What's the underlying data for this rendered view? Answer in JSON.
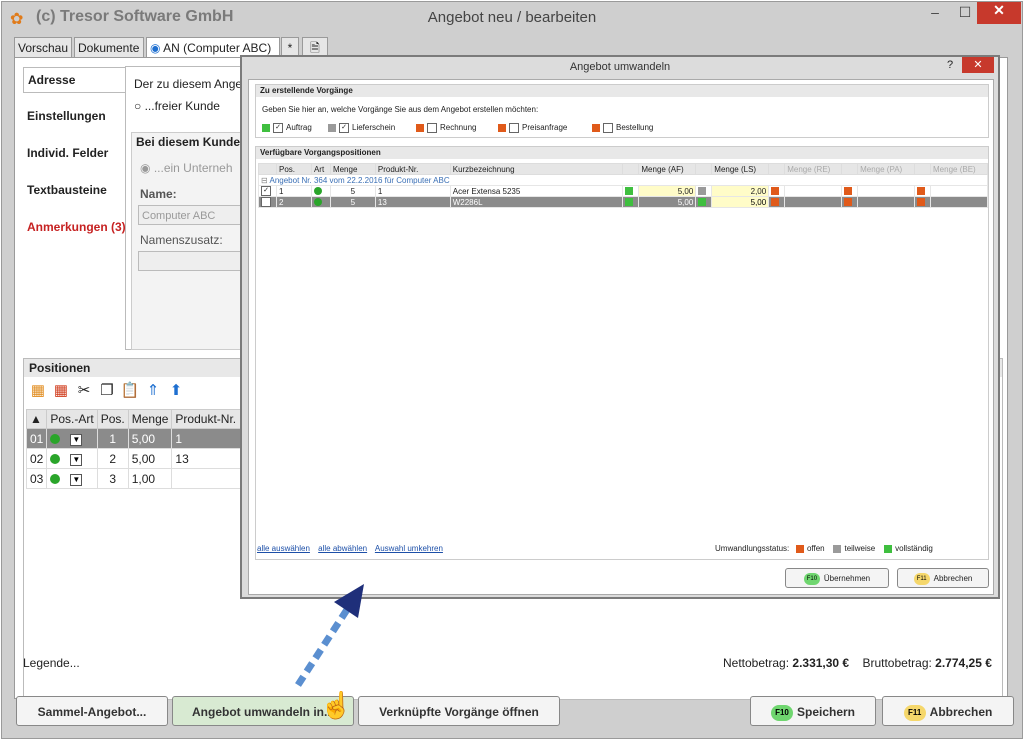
{
  "app": {
    "title": "(c) Tresor Software GmbH",
    "doc_title": "Angebot neu / bearbeiten",
    "min": "–",
    "max": "☐",
    "close": "✕"
  },
  "tabs": {
    "vorschau": "Vorschau",
    "dokumente": "Dokumente",
    "an": "AN (Computer ABC)",
    "star": "*"
  },
  "nav": {
    "adresse": "Adresse",
    "einstellungen": "Einstellungen",
    "felder": "Individ. Felder",
    "textbausteine": "Textbausteine",
    "anmerkungen": "Anmerkungen (3)"
  },
  "address": {
    "question": "Der zu diesem Ange",
    "radio_free": "...freier Kunde",
    "section": "Bei diesem Kunder",
    "radio_company": "...ein Unterneh",
    "name_label": "Name:",
    "name_value": "Computer ABC",
    "namenszusatz_label": "Namenszusatz:"
  },
  "positions": {
    "title": "Positionen",
    "headers": [
      "▲",
      "Pos.-Art",
      "Pos.",
      "Menge",
      "Produkt-Nr."
    ],
    "rows": [
      {
        "idx": "01",
        "pos": "1",
        "menge": "5,00",
        "produkt": "1"
      },
      {
        "idx": "02",
        "pos": "2",
        "menge": "5,00",
        "produkt": "13"
      },
      {
        "idx": "03",
        "pos": "3",
        "menge": "1,00",
        "produkt": ""
      }
    ],
    "legende": "Legende...",
    "netto_label": "Nettobetrag:",
    "netto_value": "2.331,30 €",
    "brutto_label": "Bruttobetrag:",
    "brutto_value": "2.774,25 €"
  },
  "buttons": {
    "sammel": "Sammel-Angebot...",
    "umwandeln": "Angebot umwandeln in...",
    "verknuepft": "Verknüpfte Vorgänge öffnen",
    "speichern": "Speichern",
    "speichern_key": "F10",
    "abbrechen": "Abbrechen",
    "abbrechen_key": "F11"
  },
  "dialog": {
    "title": "Angebot umwandeln",
    "help": "?",
    "close": "✕",
    "group1": "Zu erstellende Vorgänge",
    "hint": "Geben Sie hier an, welche Vorgänge Sie aus dem Angebot erstellen möchten:",
    "options": [
      {
        "label": "Auftrag",
        "checked": true,
        "color": "#3fbf3f"
      },
      {
        "label": "Lieferschein",
        "checked": true,
        "color": "#9a9a9a"
      },
      {
        "label": "Rechnung",
        "checked": false,
        "color": "#e05a1a"
      },
      {
        "label": "Preisanfrage",
        "checked": false,
        "color": "#e05a1a"
      },
      {
        "label": "Bestellung",
        "checked": false,
        "color": "#e05a1a"
      }
    ],
    "group2": "Verfügbare Vorgangspositionen",
    "headers": [
      "Pos.",
      "Art",
      "Menge",
      "Produkt-Nr.",
      "Kurzbezeichnung",
      "Menge (AF)",
      "Menge (LS)",
      "Menge (RE)",
      "Menge (PA)",
      "Menge (BE)"
    ],
    "group_row": "Angebot Nr. 364 vom 22.2.2016 für Computer ABC",
    "rows": [
      {
        "pos": "1",
        "menge": "5",
        "produkt": "1",
        "kurz": "Acer Extensa 5235",
        "af": "5,00",
        "ls": "2,00"
      },
      {
        "pos": "2",
        "menge": "5",
        "produkt": "13",
        "kurz": "W2286L",
        "af": "5,00",
        "ls": "5,00"
      }
    ],
    "link_all": "alle auswählen",
    "link_none": "alle abwählen",
    "link_invert": "Auswahl umkehren",
    "status_label": "Umwandlungsstatus:",
    "status_open": "offen",
    "status_partial": "teilweise",
    "status_done": "vollständig",
    "btn_ok": "Übernehmen",
    "btn_ok_key": "F10",
    "btn_cancel": "Abbrechen",
    "btn_cancel_key": "F11"
  },
  "colors": {
    "accent": "#2aa52a",
    "warning": "#c62222",
    "close": "#c7392c"
  }
}
